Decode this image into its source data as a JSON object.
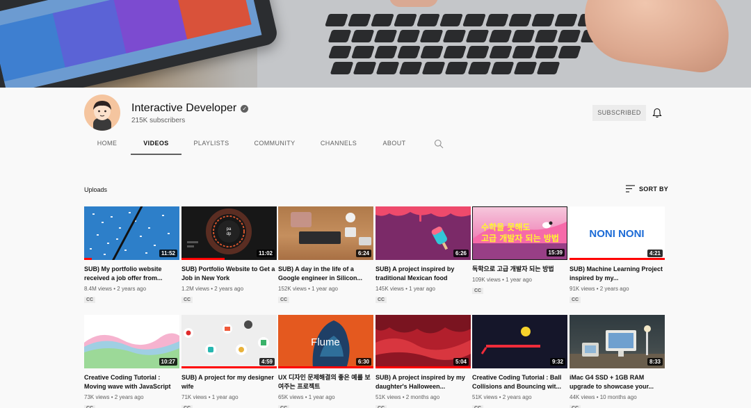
{
  "channel": {
    "name": "Interactive Developer",
    "subscribers": "215K subscribers",
    "subscribe_label": "SUBSCRIBED"
  },
  "tabs": [
    {
      "label": "HOME",
      "active": false
    },
    {
      "label": "VIDEOS",
      "active": true
    },
    {
      "label": "PLAYLISTS",
      "active": false
    },
    {
      "label": "COMMUNITY",
      "active": false
    },
    {
      "label": "CHANNELS",
      "active": false
    },
    {
      "label": "ABOUT",
      "active": false
    }
  ],
  "section": {
    "title": "Uploads",
    "sort_label": "SORT BY"
  },
  "videos": [
    {
      "title": "SUB) My portfolio website received a job offer from...",
      "views": "8.4M views",
      "age": "2 years ago",
      "duration": "11:52",
      "cc": "CC",
      "progress": 0.08
    },
    {
      "title": "SUB) Portfolio Website to Get a Job in New York",
      "views": "1.2M views",
      "age": "2 years ago",
      "duration": "11:02",
      "cc": "CC",
      "progress": 0.45
    },
    {
      "title": "SUB) A day in the life of a Google engineer in Silicon...",
      "views": "152K views",
      "age": "1 year ago",
      "duration": "6:24",
      "cc": "CC",
      "progress": 0
    },
    {
      "title": "SUB) A project inspired by traditional Mexican food",
      "views": "145K views",
      "age": "1 year ago",
      "duration": "6:26",
      "cc": "CC",
      "progress": 0
    },
    {
      "title": "독학으로 고급 개발자 되는 방법",
      "views": "109K views",
      "age": "1 year ago",
      "duration": "15:39",
      "cc": "CC",
      "progress": 0
    },
    {
      "title": "SUB) Machine Learning Project inspired by my...",
      "views": "91K views",
      "age": "2 years ago",
      "duration": "4:21",
      "cc": "CC",
      "progress": 1.0
    },
    {
      "title": "Creative Coding Tutorial : Moving wave with JavaScript",
      "views": "73K views",
      "age": "2 years ago",
      "duration": "10:27",
      "cc": "CC",
      "progress": 0
    },
    {
      "title": "SUB) A project for my designer wife",
      "views": "71K views",
      "age": "1 year ago",
      "duration": "4:59",
      "cc": "CC",
      "progress": 1.0
    },
    {
      "title": "UX 디자인 문제해결의 좋은 예를 보여주는 프로젝트",
      "views": "65K views",
      "age": "1 year ago",
      "duration": "6:30",
      "cc": "CC",
      "progress": 1.0
    },
    {
      "title": "SUB) A project inspired by my daughter's Halloween...",
      "views": "51K views",
      "age": "2 months ago",
      "duration": "5:04",
      "cc": "CC",
      "progress": 1.0
    },
    {
      "title": "Creative Coding Tutorial : Ball Collisions and Bouncing wit...",
      "views": "51K views",
      "age": "2 years ago",
      "duration": "9:32",
      "cc": "CC",
      "progress": 0
    },
    {
      "title": "iMac G4 SSD + 1GB RAM upgrade to showcase your...",
      "views": "44K views",
      "age": "10 months ago",
      "duration": "8:33",
      "cc": "CC",
      "progress": 0
    }
  ],
  "thumb_texts": {
    "ring_label": "pa dp",
    "noni": "NONI NONI",
    "flume": "Flume",
    "pink_top": "수학을 못해도",
    "pink_bottom": "고급 개발자 되는 방법"
  },
  "icons": {
    "verified": "check-circle-icon",
    "bell": "bell-icon",
    "search": "search-icon",
    "sort": "sort-lines-icon"
  },
  "colors": {
    "accent_red": "#ff0000",
    "text_primary": "#0f0f0f",
    "text_secondary": "#606060",
    "background": "#f9f9f9"
  }
}
